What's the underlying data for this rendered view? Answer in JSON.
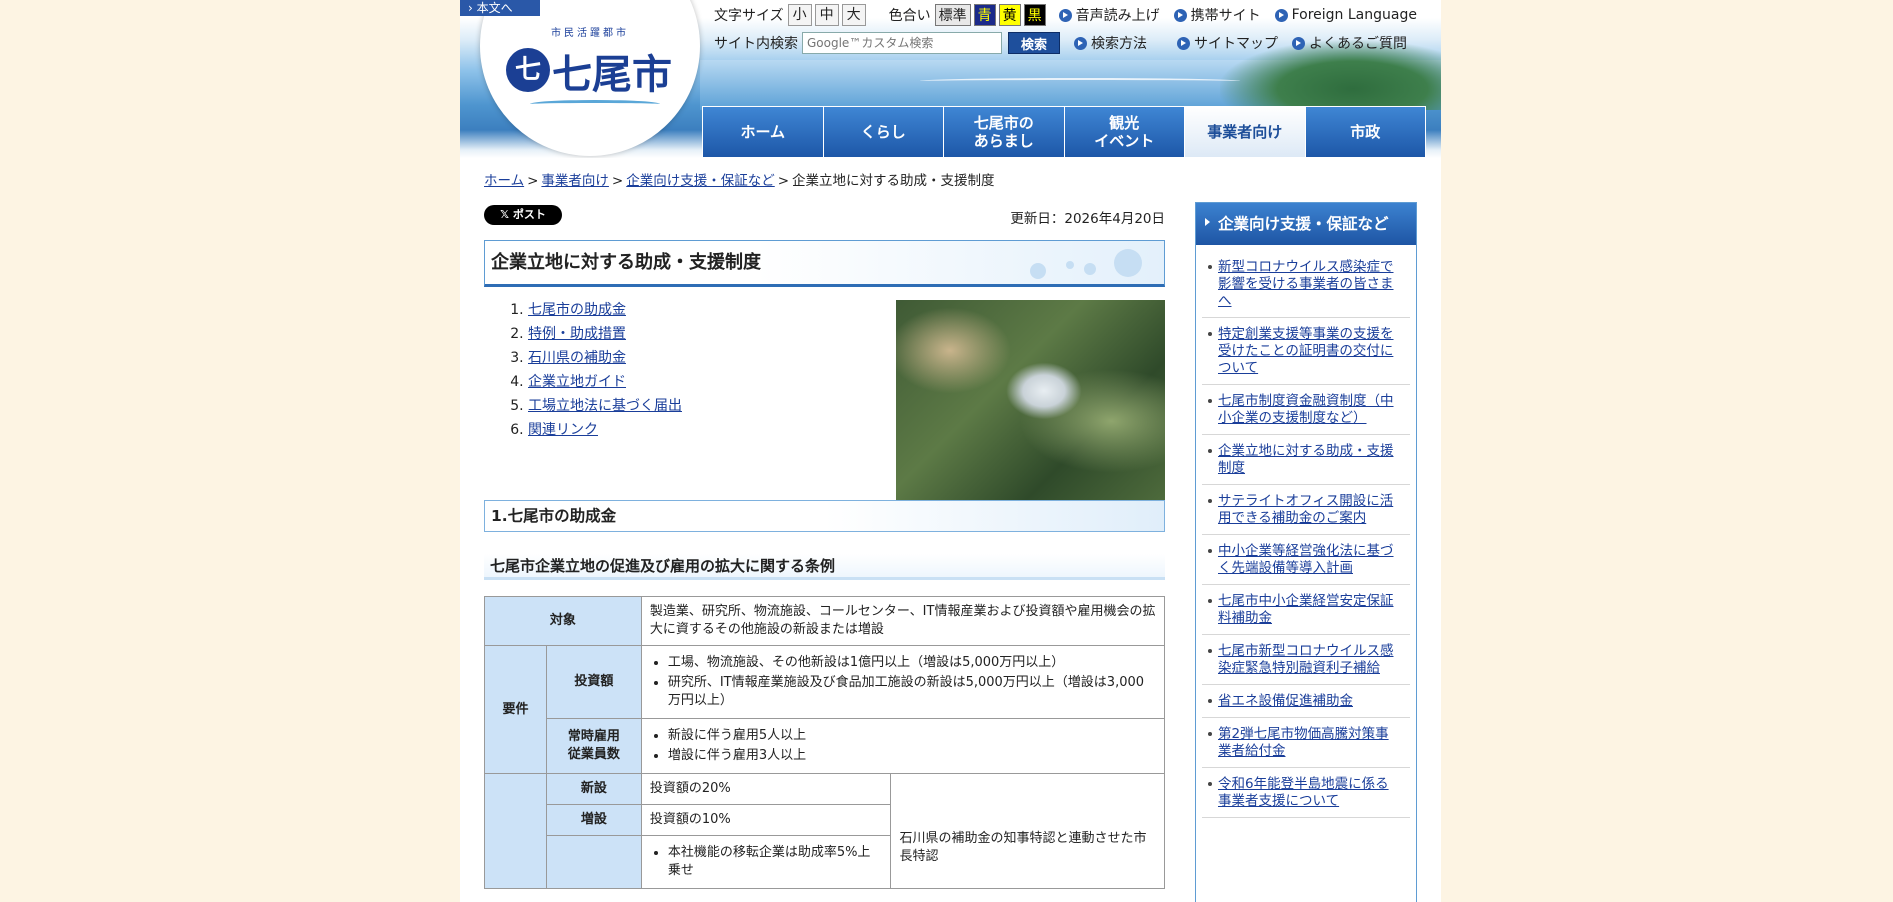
{
  "header": {
    "skip_link": "本文へ",
    "logo_small": "市民活躍都市",
    "logo_name": "七尾市",
    "text_size_label": "文字サイズ",
    "text_sizes": [
      "小",
      "中",
      "大"
    ],
    "color_label": "色合い",
    "colors": {
      "standard": "標準",
      "blue": "青",
      "yellow": "黄",
      "black": "黒"
    },
    "links_row1": [
      "音声読み上げ",
      "携帯サイト",
      "Foreign Language"
    ],
    "search_label": "サイト内検索",
    "search_placeholder": "Google™カスタム検索",
    "search_button": "検索",
    "links_row2": [
      "検索方法",
      "サイトマップ",
      "よくあるご質問"
    ]
  },
  "global_nav": [
    {
      "label": "ホーム",
      "active": false
    },
    {
      "label": "くらし",
      "active": false
    },
    {
      "label": "七尾市の\nあらまし",
      "active": false
    },
    {
      "label": "観光\nイベント",
      "active": false
    },
    {
      "label": "事業者向け",
      "active": true
    },
    {
      "label": "市政",
      "active": false
    }
  ],
  "breadcrumb": {
    "links": [
      "ホーム",
      "事業者向け",
      "企業向け支援・保証など"
    ],
    "current": "企業立地に対する助成・支援制度",
    "separator": ">"
  },
  "main": {
    "post_button": "ポスト",
    "updated": "更新日：2026年4月20日",
    "title": "企業立地に対する助成・支援制度",
    "toc": [
      "七尾市の助成金",
      "特例・助成措置",
      "石川県の補助金",
      "企業立地ガイド",
      "工場立地法に基づく届出",
      "関連リンク"
    ],
    "section1_heading": "1.七尾市の助成金",
    "sub1_heading": "七尾市企業立地の促進及び雇用の拡大に関する条例",
    "table": {
      "target_label": "対象",
      "target_value": "製造業、研究所、物流施設、コールセンター、IT情報産業および投資額や雇用機会の拡大に資するその他施設の新設または増設",
      "requirement_label": "要件",
      "investment_label": "投資額",
      "investment_items": [
        "工場、物流施設、その他新設は1億円以上（増設は5,000万円以上）",
        "研究所、IT情報産業施設及び食品加工施設の新設は5,000万円以上（増設は3,000万円以上）"
      ],
      "employment_label": "常時雇用\n従業員数",
      "employment_items": [
        "新設に伴う雇用5人以上",
        "増設に伴う雇用3人以上"
      ],
      "new_label": "新設",
      "new_value": "投資額の20%",
      "expand_label": "増設",
      "expand_value": "投資額の10%",
      "hq_items": [
        "本社機能の移転企業は助成率5%上乗せ"
      ],
      "special_note": "石川県の補助金の知事特認と連動させた市長特認"
    }
  },
  "sidebar": {
    "title": "企業向け支援・保証など",
    "items": [
      "新型コロナウイルス感染症で影響を受ける事業者の皆さまへ",
      "特定創業支援等事業の支援を受けたことの証明書の交付について",
      "七尾市制度資金融資制度（中小企業の支援制度など）",
      "企業立地に対する助成・支援制度",
      "サテライトオフィス開設に活用できる補助金のご案内",
      "中小企業等経営強化法に基づく先端設備等導入計画",
      "七尾市中小企業経営安定保証料補助金",
      "七尾市新型コロナウイルス感染症緊急特別融資利子補給",
      "省エネ設備促進補助金",
      "第2弾七尾市物価高騰対策事業者給付金",
      "令和6年能登半島地震に係る事業者支援について"
    ]
  },
  "colors": {
    "nav_blue": "#1d57a8",
    "link": "#1a3e9a",
    "table_header": "#cce2f7",
    "page_bg": "#fdf4e3"
  }
}
